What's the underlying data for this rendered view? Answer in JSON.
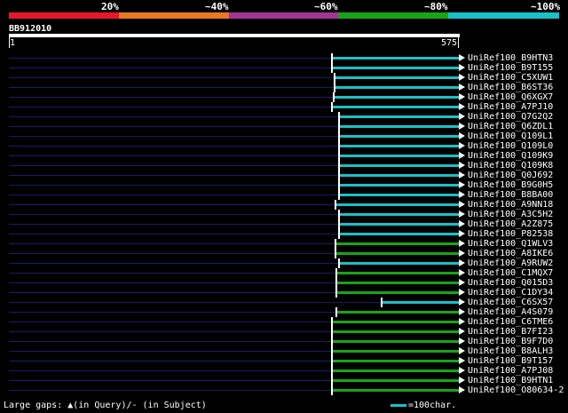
{
  "legend": {
    "labels": [
      "20%",
      "~40%",
      "~60%",
      "~80%",
      "~100%"
    ],
    "colors": [
      "#e8172d",
      "#e87822",
      "#a33596",
      "#17a517",
      "#19c1c8"
    ]
  },
  "query": {
    "id": "BB912010",
    "start_label": "1",
    "end_label": "575",
    "length": 575
  },
  "hits": [
    {
      "name": "UniRef100_B9HTN3",
      "start": 412,
      "color": "#19c1c8"
    },
    {
      "name": "UniRef100_B9T155",
      "start": 412,
      "color": "#19c1c8"
    },
    {
      "name": "UniRef100_C5XUW1",
      "start": 415,
      "color": "#19c1c8"
    },
    {
      "name": "UniRef100_B6ST36",
      "start": 415,
      "color": "#19c1c8"
    },
    {
      "name": "UniRef100_Q6XGX7",
      "start": 414,
      "color": "#19c1c8"
    },
    {
      "name": "UniRef100_A7PJ10",
      "start": 412,
      "color": "#19c1c8"
    },
    {
      "name": "UniRef100_Q7G2Q2",
      "start": 421,
      "color": "#19c1c8"
    },
    {
      "name": "UniRef100_Q6ZDL1",
      "start": 421,
      "color": "#19c1c8"
    },
    {
      "name": "UniRef100_Q109L1",
      "start": 421,
      "color": "#19c1c8"
    },
    {
      "name": "UniRef100_Q109L0",
      "start": 421,
      "color": "#19c1c8"
    },
    {
      "name": "UniRef100_Q109K9",
      "start": 421,
      "color": "#19c1c8"
    },
    {
      "name": "UniRef100_Q109K8",
      "start": 421,
      "color": "#19c1c8"
    },
    {
      "name": "UniRef100_Q0J692",
      "start": 421,
      "color": "#19c1c8"
    },
    {
      "name": "UniRef100_B9G0H5",
      "start": 421,
      "color": "#19c1c8"
    },
    {
      "name": "UniRef100_B8BA00",
      "start": 421,
      "color": "#19c1c8"
    },
    {
      "name": "UniRef100_A9NN18",
      "start": 416,
      "color": "#19c1c8"
    },
    {
      "name": "UniRef100_A3C5H2",
      "start": 421,
      "color": "#19c1c8"
    },
    {
      "name": "UniRef100_A2Z875",
      "start": 421,
      "color": "#19c1c8"
    },
    {
      "name": "UniRef100_P82538",
      "start": 421,
      "color": "#19c1c8"
    },
    {
      "name": "UniRef100_Q1WLV3",
      "start": 416,
      "color": "#17a517"
    },
    {
      "name": "UniRef100_A8IKE6",
      "start": 416,
      "color": "#17a517"
    },
    {
      "name": "UniRef100_A9RUW2",
      "start": 421,
      "color": "#19c1c8"
    },
    {
      "name": "UniRef100_C1MQX7",
      "start": 418,
      "color": "#17a517"
    },
    {
      "name": "UniRef100_Q015D3",
      "start": 418,
      "color": "#17a517"
    },
    {
      "name": "UniRef100_C1DY34",
      "start": 418,
      "color": "#17a517"
    },
    {
      "name": "UniRef100_C6SX57",
      "start": 475,
      "color": "#19c1c8"
    },
    {
      "name": "UniRef100_A4S079",
      "start": 418,
      "color": "#17a517"
    },
    {
      "name": "UniRef100_C6TME6",
      "start": 412,
      "color": "#17a517"
    },
    {
      "name": "UniRef100_B7FI23",
      "start": 412,
      "color": "#17a517"
    },
    {
      "name": "UniRef100_B9F7D0",
      "start": 412,
      "color": "#17a517"
    },
    {
      "name": "UniRef100_B8ALH3",
      "start": 412,
      "color": "#17a517"
    },
    {
      "name": "UniRef100_B9T157",
      "start": 412,
      "color": "#17a517"
    },
    {
      "name": "UniRef100_A7PJ08",
      "start": 412,
      "color": "#17a517"
    },
    {
      "name": "UniRef100_B9HTN1",
      "start": 412,
      "color": "#17a517"
    },
    {
      "name": "UniRef100_O80634-2",
      "start": 412,
      "color": "#17a517"
    }
  ],
  "footer": {
    "gaps_text": "Large gaps: ▲(in Query)/- (in Subject)",
    "scale_text": "=100char.",
    "scale_color": "#19c1c8"
  }
}
